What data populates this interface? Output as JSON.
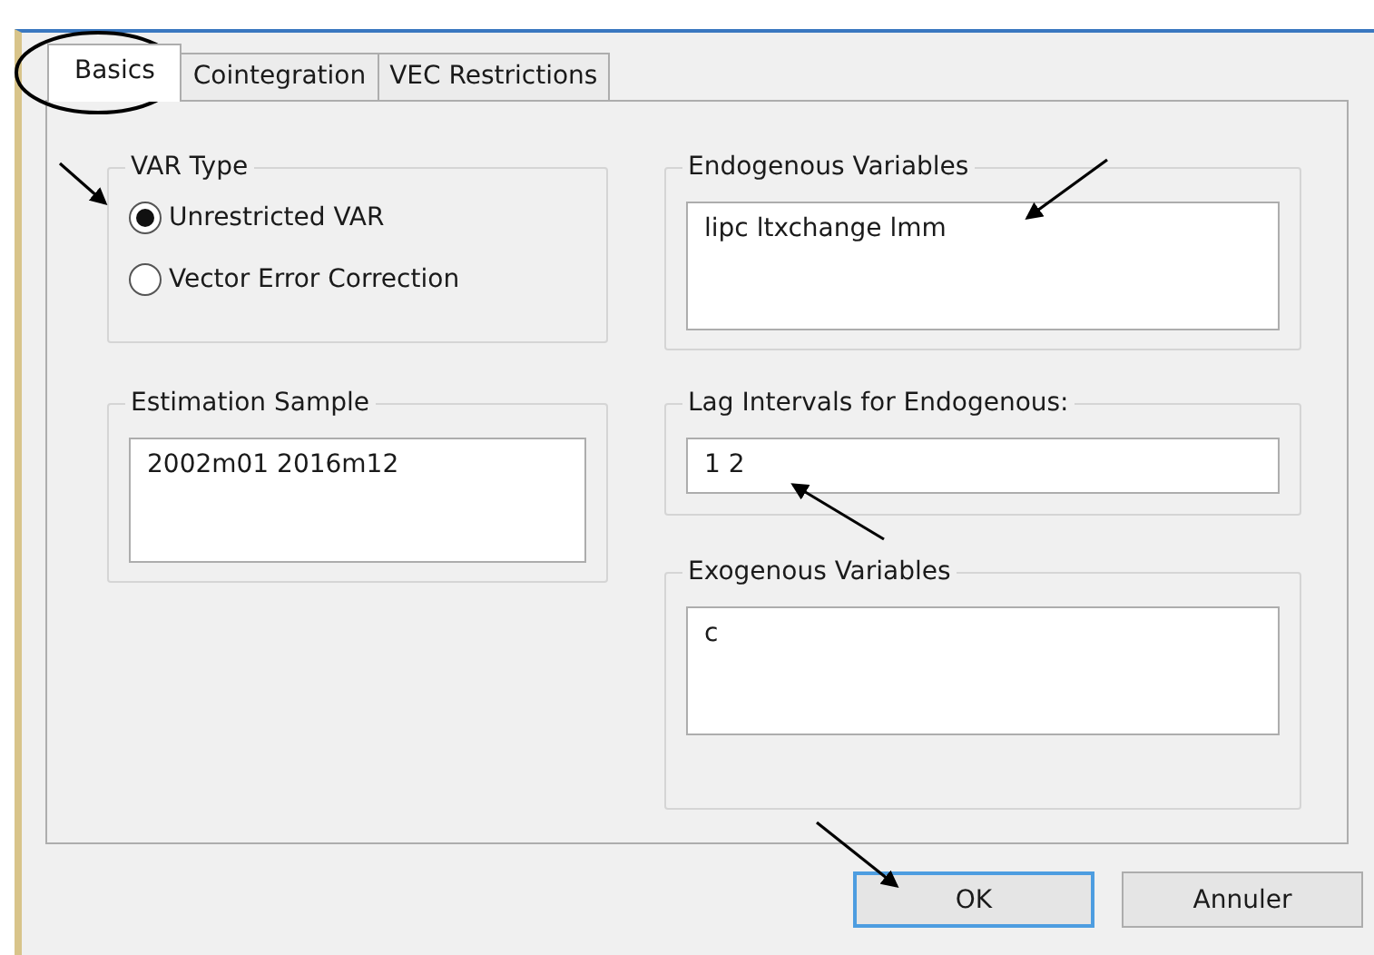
{
  "tabs": [
    {
      "label": "Basics",
      "selected": true
    },
    {
      "label": "Cointegration",
      "selected": false
    },
    {
      "label": "VEC Restrictions",
      "selected": false
    }
  ],
  "var_type": {
    "title": "VAR Type",
    "options": [
      {
        "label": "Unrestricted VAR",
        "selected": true
      },
      {
        "label": "Vector Error Correction",
        "selected": false
      }
    ]
  },
  "estimation_sample": {
    "title": "Estimation Sample",
    "value": "2002m01 2016m12"
  },
  "endogenous_variables": {
    "title": "Endogenous Variables",
    "value": "lipc ltxchange lmm"
  },
  "lag_intervals": {
    "title": "Lag Intervals for Endogenous:",
    "value": "1 2"
  },
  "exogenous_variables": {
    "title": "Exogenous Variables",
    "value": "c"
  },
  "buttons": [
    {
      "label": "OK",
      "default": true
    },
    {
      "label": "Annuler",
      "default": false
    }
  ]
}
